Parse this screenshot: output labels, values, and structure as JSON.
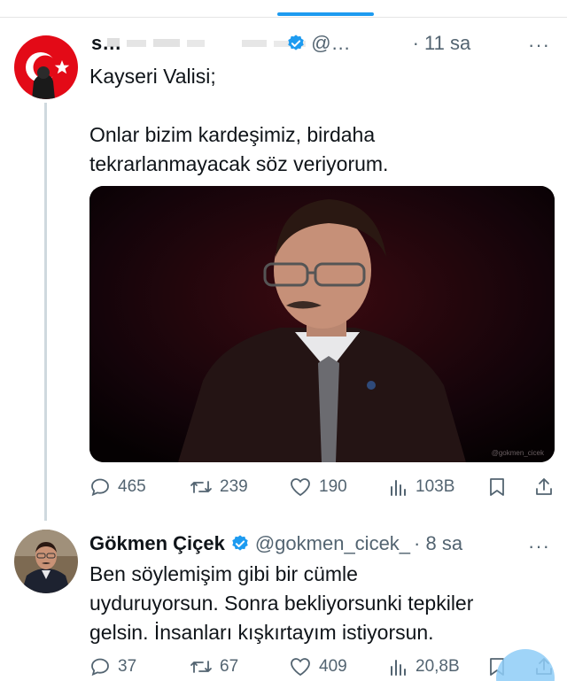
{
  "tweets": [
    {
      "name": "s…",
      "handle": "@…",
      "time": "· 11 sa",
      "more": "···",
      "text": "Kayseri Valisi;\n\nOnlar bizim kardeşimiz, birdaha\ntekrarlanmayacak söz veriyorum.",
      "photo_credit": "@gokmen_cicek",
      "stats": {
        "replies": "465",
        "retweets": "239",
        "likes": "190",
        "views": "103B"
      }
    },
    {
      "name": "Gökmen Çiçek",
      "handle": "@gokmen_cicek_",
      "time": "· 8 sa",
      "more": "···",
      "text": "Ben söylemişim gibi bir cümle\nuyduruyorsun. Sonra bekliyorsunki tepkiler\ngelsin. İnsanları kışkırtayım istiyorsun.",
      "stats": {
        "replies": "37",
        "retweets": "67",
        "likes": "409",
        "views": "20,8B"
      }
    }
  ],
  "colors": {
    "accent": "#1d9bf0",
    "text": "#0f1419",
    "muted": "#536471",
    "turkey_red": "#e30a17"
  },
  "icons": [
    "reply-icon",
    "retweet-icon",
    "like-icon",
    "views-icon",
    "bookmark-icon",
    "share-icon",
    "verified-badge-icon"
  ]
}
